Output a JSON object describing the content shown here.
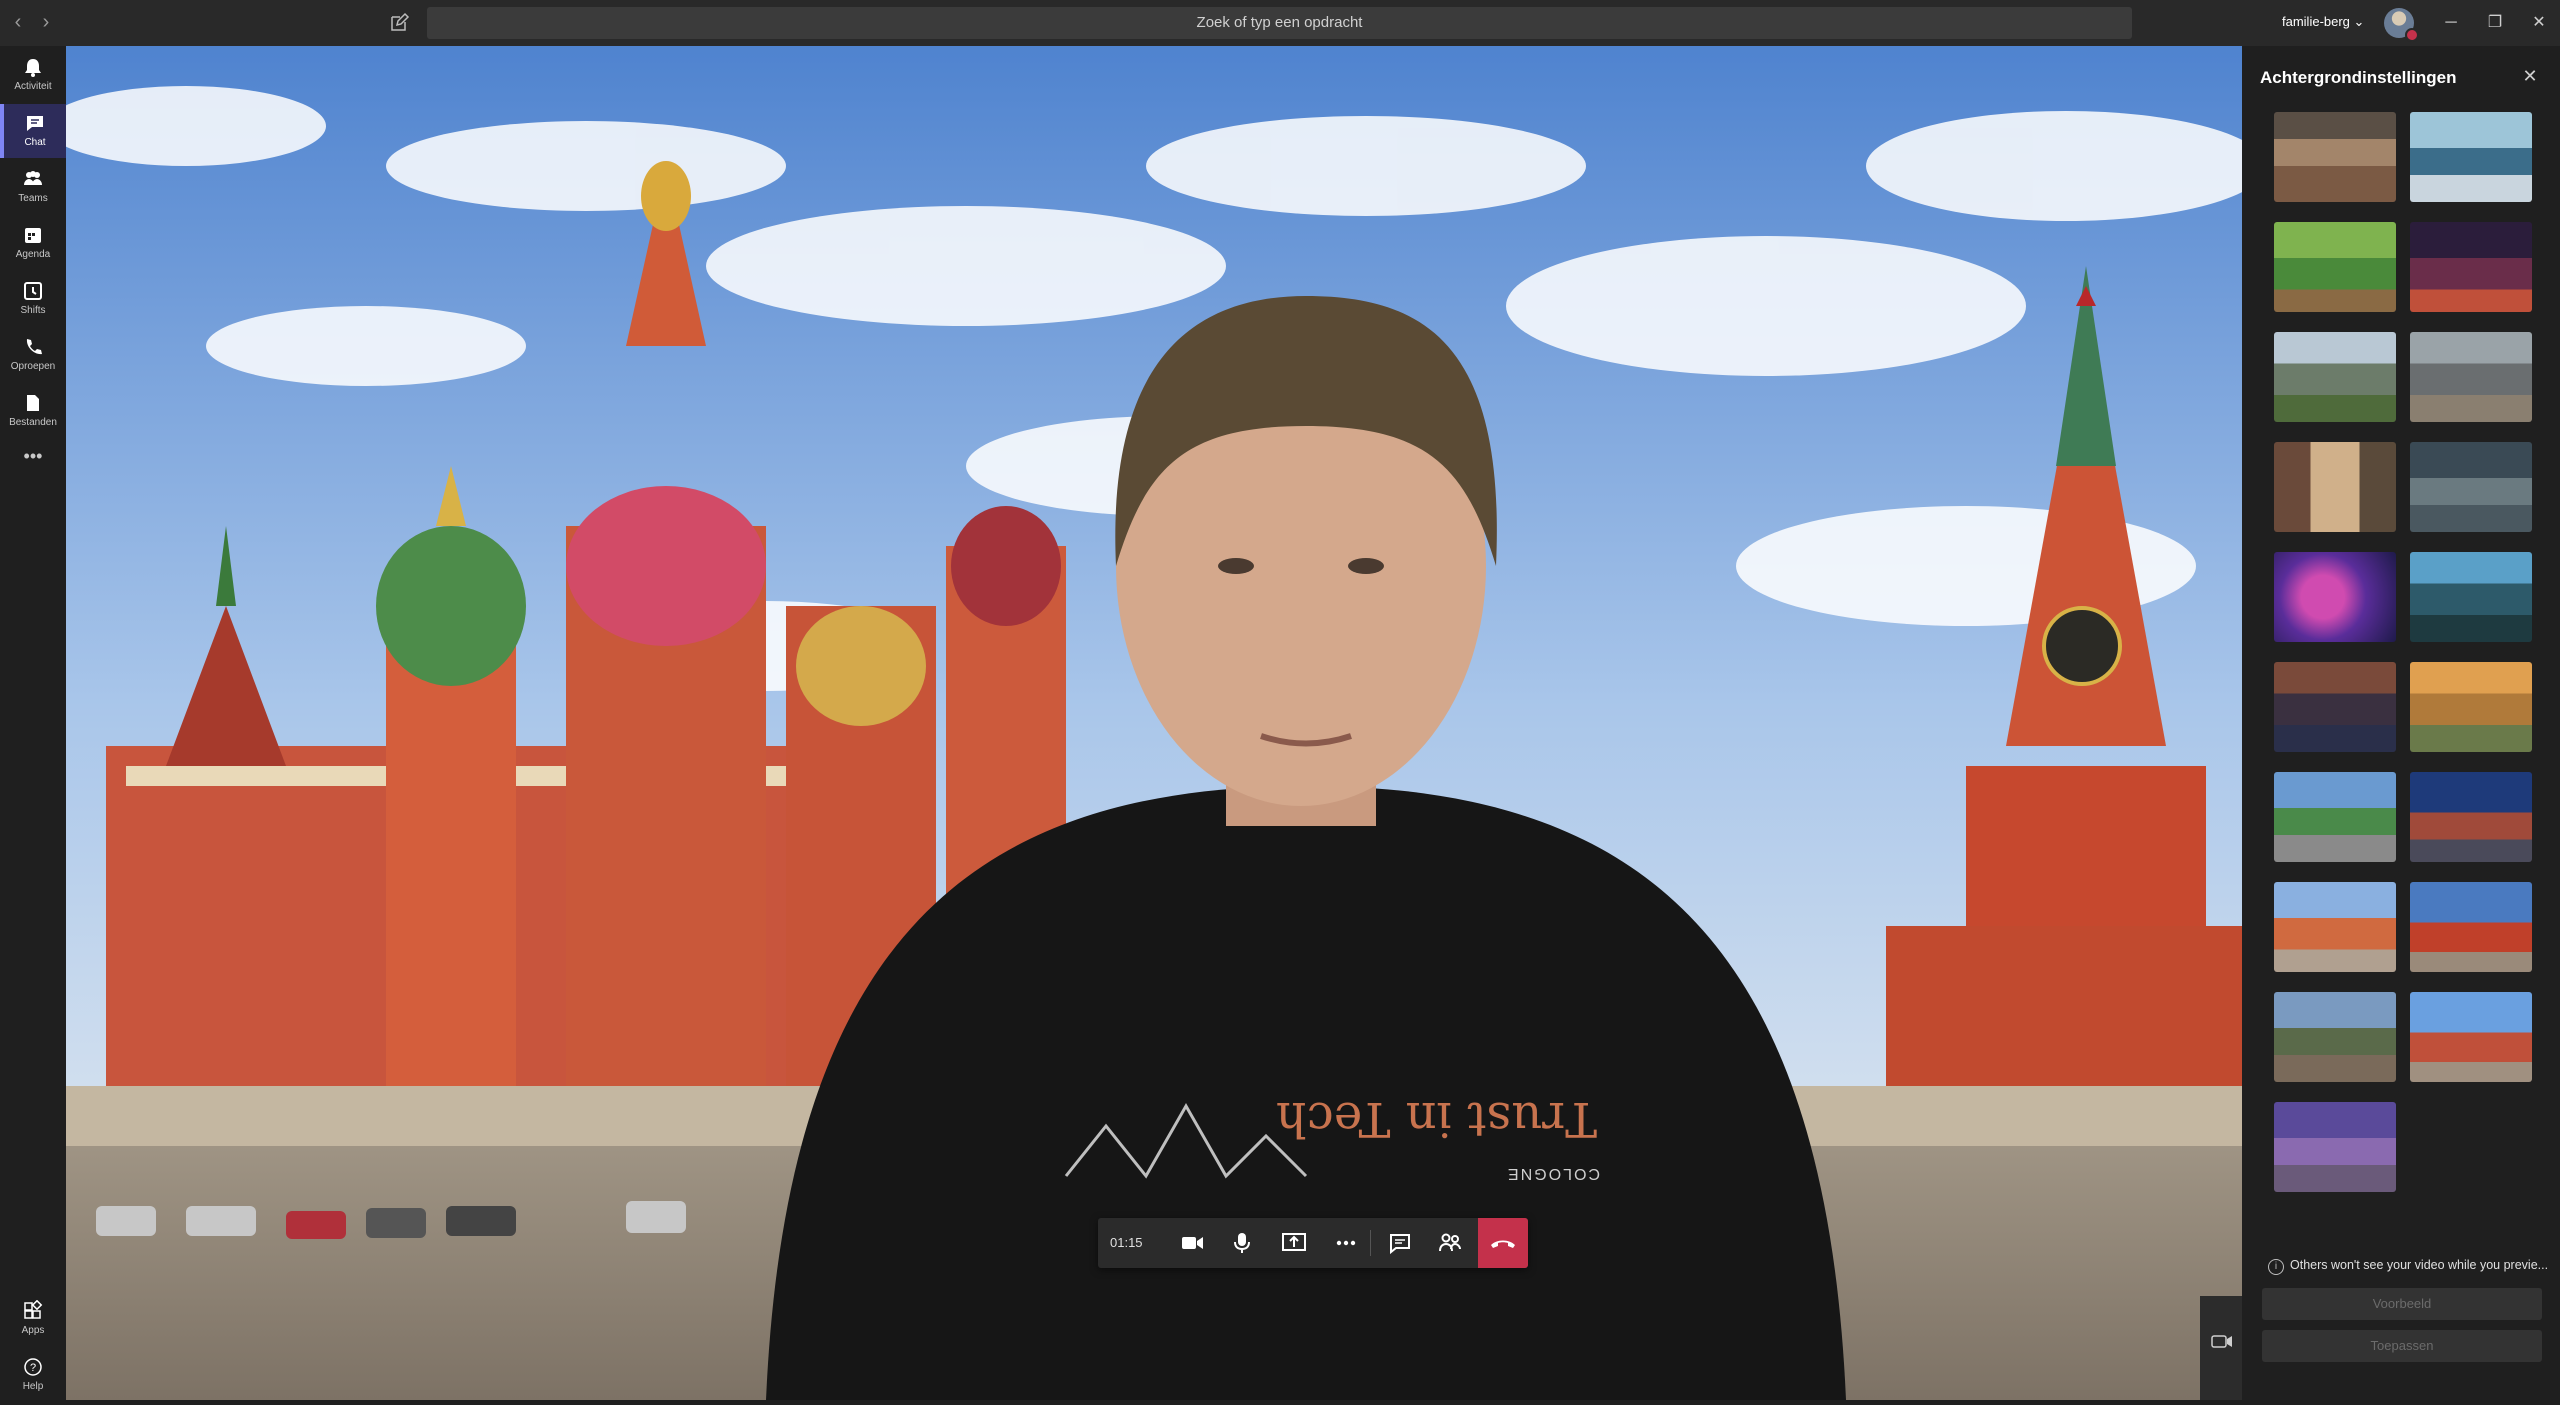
{
  "titlebar": {
    "search_placeholder": "Zoek of typ een opdracht",
    "tenant": "familie-berg ⌄"
  },
  "rail": {
    "items": [
      {
        "label": "Activiteit",
        "icon": "bell-icon"
      },
      {
        "label": "Chat",
        "icon": "chat-icon",
        "active": true
      },
      {
        "label": "Teams",
        "icon": "teams-icon"
      },
      {
        "label": "Agenda",
        "icon": "calendar-icon"
      },
      {
        "label": "Shifts",
        "icon": "clock-icon"
      },
      {
        "label": "Oproepen",
        "icon": "phone-icon"
      },
      {
        "label": "Bestanden",
        "icon": "file-icon"
      }
    ],
    "more": "•••",
    "bottom": [
      {
        "label": "Apps",
        "icon": "apps-icon"
      },
      {
        "label": "Help",
        "icon": "help-icon"
      }
    ]
  },
  "call": {
    "timer": "01:15",
    "shirt_text": "Trust in Tech",
    "shirt_subtext": "COLOGNE",
    "accent": "#c4314b"
  },
  "panel": {
    "title": "Achtergrondinstellingen",
    "thumbnails": [
      "classroom",
      "office-lab",
      "minecraft-village",
      "minecraft-night",
      "mountain-valley",
      "sci-fi-arch",
      "fantasy-alley",
      "alien-planet",
      "nebula",
      "forest-sunset",
      "canal-town",
      "fantasy-landscape",
      "st-petersburg-church",
      "red-square-night",
      "st-basils-cathedral",
      "state-museum",
      "spilled-blood-church",
      "red-square-day",
      "spilled-blood-dusk"
    ],
    "note": "Others won't see your video while you previe...",
    "preview_label": "Voorbeeld",
    "apply_label": "Toepassen"
  }
}
